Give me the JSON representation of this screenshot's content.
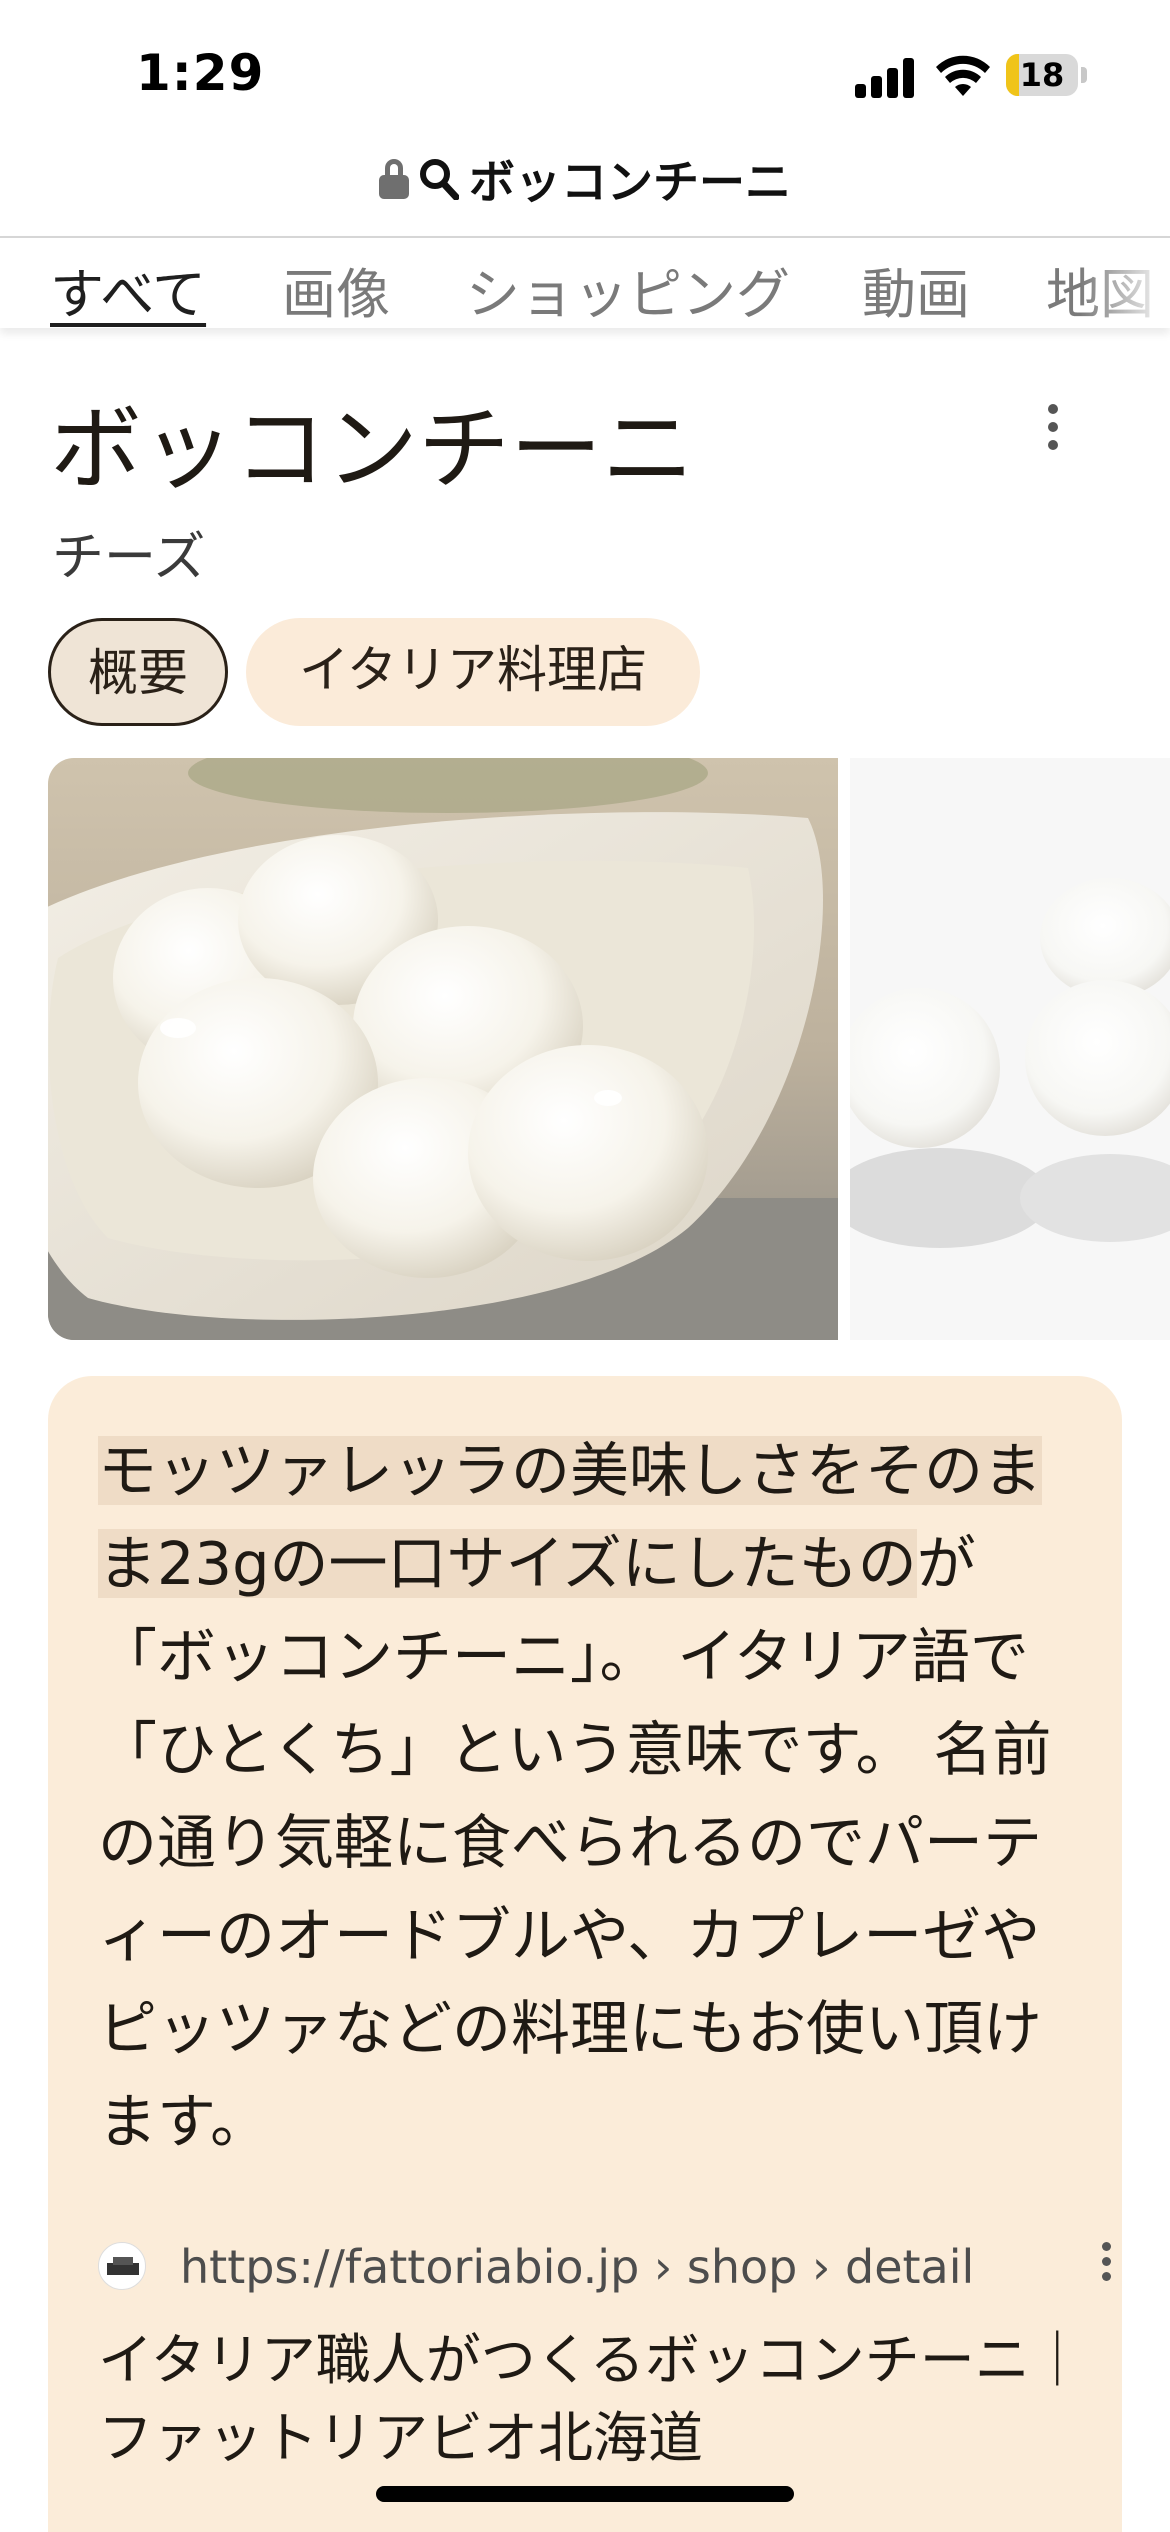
{
  "status_bar": {
    "time": "1:29",
    "battery_level": "18",
    "battery_fraction": 0.18,
    "icons": [
      "signal-icon",
      "wifi-icon",
      "battery-icon"
    ]
  },
  "url_bar": {
    "query": "ボッコンチーニ",
    "icons": [
      "lock-icon",
      "search-icon"
    ]
  },
  "tabs": [
    {
      "label": "すべて",
      "active": true
    },
    {
      "label": "画像"
    },
    {
      "label": "ショッピング"
    },
    {
      "label": "動画"
    },
    {
      "label": "地図"
    }
  ],
  "knowledge_panel": {
    "title": "ボッコンチーニ",
    "subtitle": "チーズ",
    "chips": [
      {
        "label": "概要",
        "selected": true
      },
      {
        "label": "イタリア料理店"
      }
    ],
    "images": [
      {
        "alt": "bocconcini-in-spoon"
      },
      {
        "alt": "bocconcini-on-white"
      }
    ]
  },
  "description": {
    "highlighted": "モッツァレッラの美味しさをそのまま23gの一口サイズにしたもの",
    "rest": "が「ボッコンチーニ」。 イタリア語で「ひとくち」という意味です。 名前の通り気軽に食べられるのでパーティーのオードブルや、カプレーゼやピッツァなどの料理にもお使い頂けます。"
  },
  "source": {
    "url": "https://fattoriabio.jp › shop › detail",
    "title": "イタリア職人がつくるボッコンチーニ｜ファットリアビオ北海道"
  },
  "colors": {
    "card_bg": "#fbecd9",
    "highlight": "#efdcc6",
    "chip_selected": "#efe4d6",
    "battery": "#f0c419"
  }
}
